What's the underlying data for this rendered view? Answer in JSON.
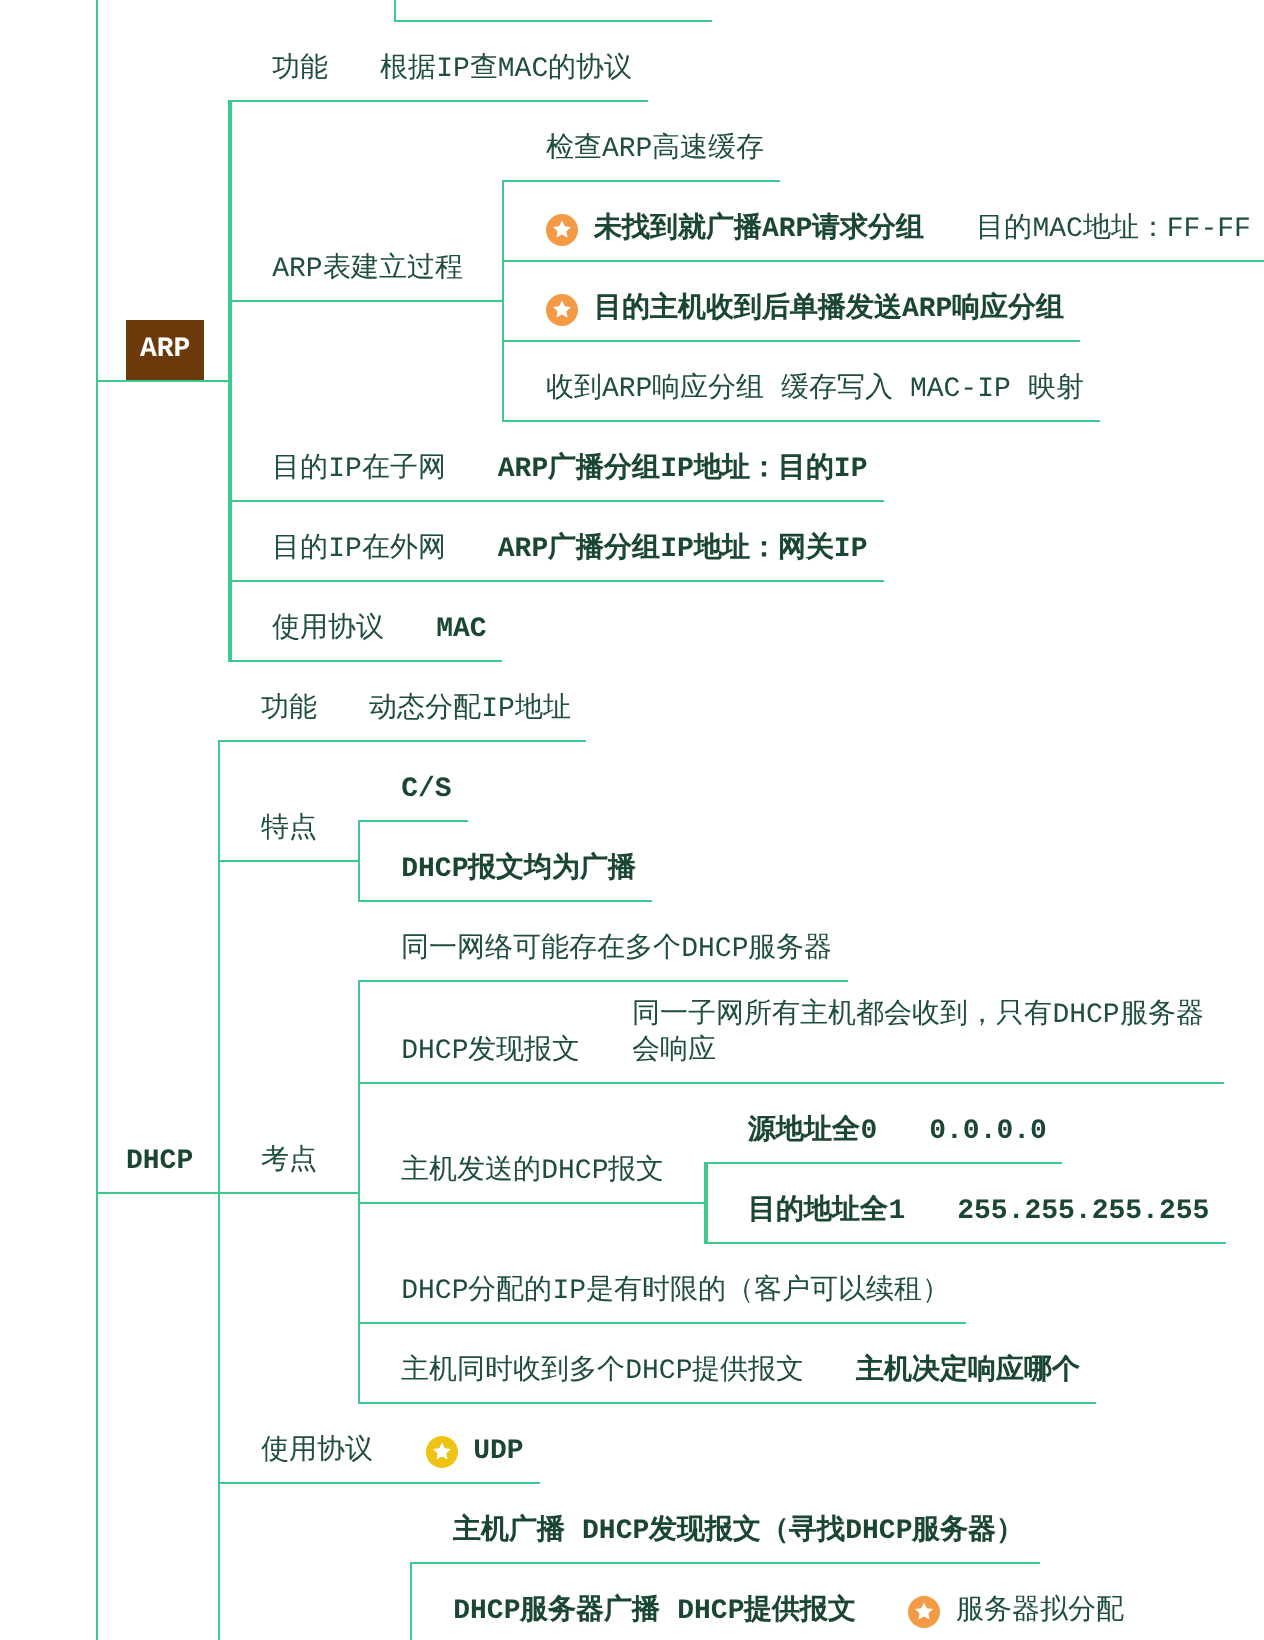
{
  "mind_map": {
    "branches": [
      {
        "parts": [
          {
            "text": "ARP",
            "bold": true,
            "starred": false
          }
        ],
        "selected": true,
        "children": [
          {
            "parts": [
              {
                "text": "功能",
                "bold": false,
                "starred": false
              },
              {
                "text": "根据IP查MAC的协议",
                "bold": false,
                "starred": false
              }
            ]
          },
          {
            "parts": [
              {
                "text": "ARP表建立过程",
                "bold": false,
                "starred": false
              }
            ],
            "children": [
              {
                "parts": [
                  {
                    "text": "检查ARP高速缓存",
                    "bold": false,
                    "starred": false
                  }
                ]
              },
              {
                "parts": [
                  {
                    "text": "未找到就广播ARP请求分组",
                    "bold": true,
                    "starred": true,
                    "color": "#f39a44"
                  },
                  {
                    "text": "目的MAC地址：FF-FF",
                    "bold": false,
                    "starred": false
                  }
                ]
              },
              {
                "parts": [
                  {
                    "text": "目的主机收到后单播发送ARP响应分组",
                    "bold": true,
                    "starred": true,
                    "color": "#f39a44"
                  }
                ]
              },
              {
                "parts": [
                  {
                    "text": "收到ARP响应分组 缓存写入 MAC-IP 映射",
                    "bold": false,
                    "starred": false
                  }
                ]
              }
            ]
          },
          {
            "parts": [
              {
                "text": "目的IP在子网",
                "bold": false,
                "starred": false
              },
              {
                "text": "ARP广播分组IP地址：目的IP",
                "bold": true,
                "starred": false
              }
            ]
          },
          {
            "parts": [
              {
                "text": "目的IP在外网",
                "bold": false,
                "starred": false
              },
              {
                "text": "ARP广播分组IP地址：网关IP",
                "bold": true,
                "starred": false
              }
            ]
          },
          {
            "parts": [
              {
                "text": "使用协议",
                "bold": false,
                "starred": false
              },
              {
                "text": "MAC",
                "bold": true,
                "starred": false
              }
            ]
          }
        ]
      },
      {
        "parts": [
          {
            "text": "DHCP",
            "bold": true,
            "starred": false
          }
        ],
        "selected": false,
        "children": [
          {
            "parts": [
              {
                "text": "功能",
                "bold": false,
                "starred": false
              },
              {
                "text": "动态分配IP地址",
                "bold": false,
                "starred": false
              }
            ]
          },
          {
            "parts": [
              {
                "text": "特点",
                "bold": false,
                "starred": false
              }
            ],
            "children": [
              {
                "parts": [
                  {
                    "text": "C/S",
                    "bold": true,
                    "starred": false
                  }
                ]
              },
              {
                "parts": [
                  {
                    "text": "DHCP报文均为广播",
                    "bold": true,
                    "starred": false
                  }
                ]
              }
            ]
          },
          {
            "parts": [
              {
                "text": "考点",
                "bold": false,
                "starred": false
              }
            ],
            "children": [
              {
                "parts": [
                  {
                    "text": "同一网络可能存在多个DHCP服务器",
                    "bold": false,
                    "starred": false
                  }
                ]
              },
              {
                "parts": [
                  {
                    "text": "DHCP发现报文",
                    "bold": false,
                    "starred": false
                  },
                  {
                    "text": "同一子网所有主机都会收到，只有DHCP服务器会响应",
                    "bold": false,
                    "starred": false
                  }
                ]
              },
              {
                "parts": [
                  {
                    "text": "主机发送的DHCP报文",
                    "bold": false,
                    "starred": false
                  }
                ],
                "children": [
                  {
                    "parts": [
                      {
                        "text": "源地址全0",
                        "bold": true,
                        "starred": false
                      },
                      {
                        "text": "0.0.0.0",
                        "bold": true,
                        "starred": false
                      }
                    ]
                  },
                  {
                    "parts": [
                      {
                        "text": "目的地址全1",
                        "bold": true,
                        "starred": false
                      },
                      {
                        "text": "255.255.255.255",
                        "bold": true,
                        "starred": false
                      }
                    ]
                  }
                ]
              },
              {
                "parts": [
                  {
                    "text": "DHCP分配的IP是有时限的（客户可以续租）",
                    "bold": false,
                    "starred": false
                  }
                ]
              },
              {
                "parts": [
                  {
                    "text": "主机同时收到多个DHCP提供报文",
                    "bold": false,
                    "starred": false
                  },
                  {
                    "text": "主机决定响应哪个",
                    "bold": true,
                    "starred": false
                  }
                ]
              }
            ]
          },
          {
            "parts": [
              {
                "text": "使用协议",
                "bold": false,
                "starred": false
              },
              {
                "text": "UDP",
                "bold": true,
                "starred": true,
                "color": "#eec313"
              }
            ]
          },
          {
            "children": [
              {
                "parts": [
                  {
                    "text": "主机广播  DHCP发现报文（寻找DHCP服务器）",
                    "bold": true,
                    "starred": false
                  }
                ]
              },
              {
                "parts": [
                  {
                    "text": "DHCP服务器广播  DHCP提供报文",
                    "bold": true,
                    "starred": false
                  },
                  {
                    "text": "服务器拟分配",
                    "bold": false,
                    "starred": true,
                    "color": "#f39a44"
                  }
                ]
              }
            ]
          }
        ]
      }
    ]
  }
}
